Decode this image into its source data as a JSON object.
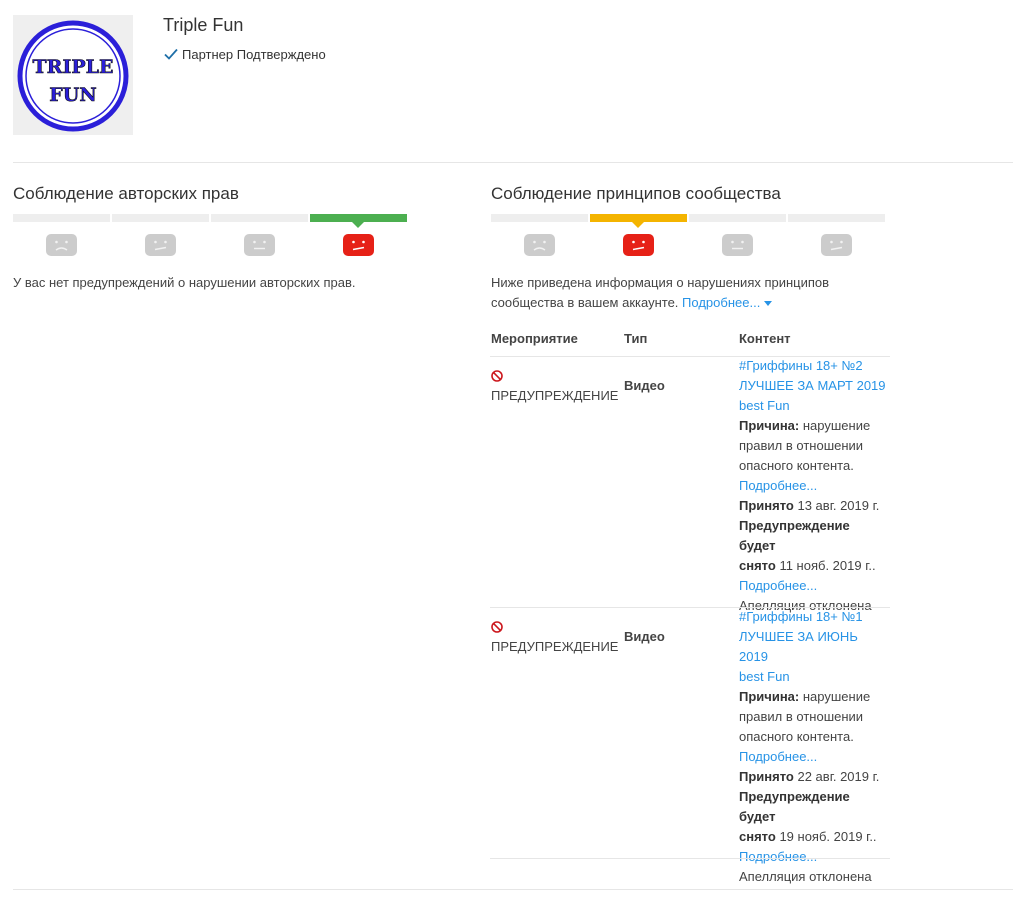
{
  "channel": {
    "name": "Triple Fun",
    "logo_text": [
      "TRIPLE",
      "FUN"
    ],
    "partner_label": "Партнер Подтверждено"
  },
  "copyright": {
    "title": "Соблюдение авторских прав",
    "level_index": 3,
    "segments": 4,
    "message": "У вас нет предупреждений о нарушении авторских прав."
  },
  "community": {
    "title": "Соблюдение принципов сообщества",
    "level_index": 1,
    "segments": 4,
    "intro": "Ниже приведена информация о нарушениях принципов сообщества в вашем аккаунте.",
    "intro_line1": "Ниже приведена информация о нарушениях принципов",
    "intro_line2": "сообщества в вашем аккаунте.",
    "more_link": "Подробнее...",
    "headers": {
      "action": "Мероприятие",
      "type": "Тип",
      "content": "Контент"
    },
    "strikes": [
      {
        "action": "ПРЕДУПРЕЖДЕНИЕ",
        "type": "Видео",
        "title_lines": [
          "#Гриффины 18+ №2",
          "ЛУЧШЕЕ ЗА МАРТ 2019",
          "best Fun"
        ],
        "reason_label": "Причина:",
        "reason_lines": [
          "нарушение",
          "правил в отношении",
          "опасного контента."
        ],
        "reason_more": "Подробнее...",
        "accepted_label": "Принято",
        "accepted_date": "13 авг. 2019 г.",
        "expires_label_1": "Предупреждение будет",
        "expires_label_2": "снято",
        "expires_date": "11 нояб. 2019 г..",
        "expires_more": "Подробнее...",
        "appeal": "Апелляция отклонена"
      },
      {
        "action": "ПРЕДУПРЕЖДЕНИЕ",
        "type": "Видео",
        "title_lines": [
          "#Гриффины 18+ №1",
          "ЛУЧШЕЕ ЗА ИЮНЬ 2019",
          "best Fun"
        ],
        "reason_label": "Причина:",
        "reason_lines": [
          "нарушение",
          "правил в отношении",
          "опасного контента."
        ],
        "reason_more": "Подробнее...",
        "accepted_label": "Принято",
        "accepted_date": "22 авг. 2019 г.",
        "expires_label_1": "Предупреждение будет",
        "expires_label_2": "снято",
        "expires_date": "19 нояб. 2019 г..",
        "expires_more": "Подробнее...",
        "appeal": "Апелляция отклонена"
      }
    ]
  },
  "colors": {
    "green": "#4caf50",
    "yellow": "#f4b400",
    "red": "#e62117",
    "link": "#2793e6",
    "grey_face": "#cccccc"
  }
}
